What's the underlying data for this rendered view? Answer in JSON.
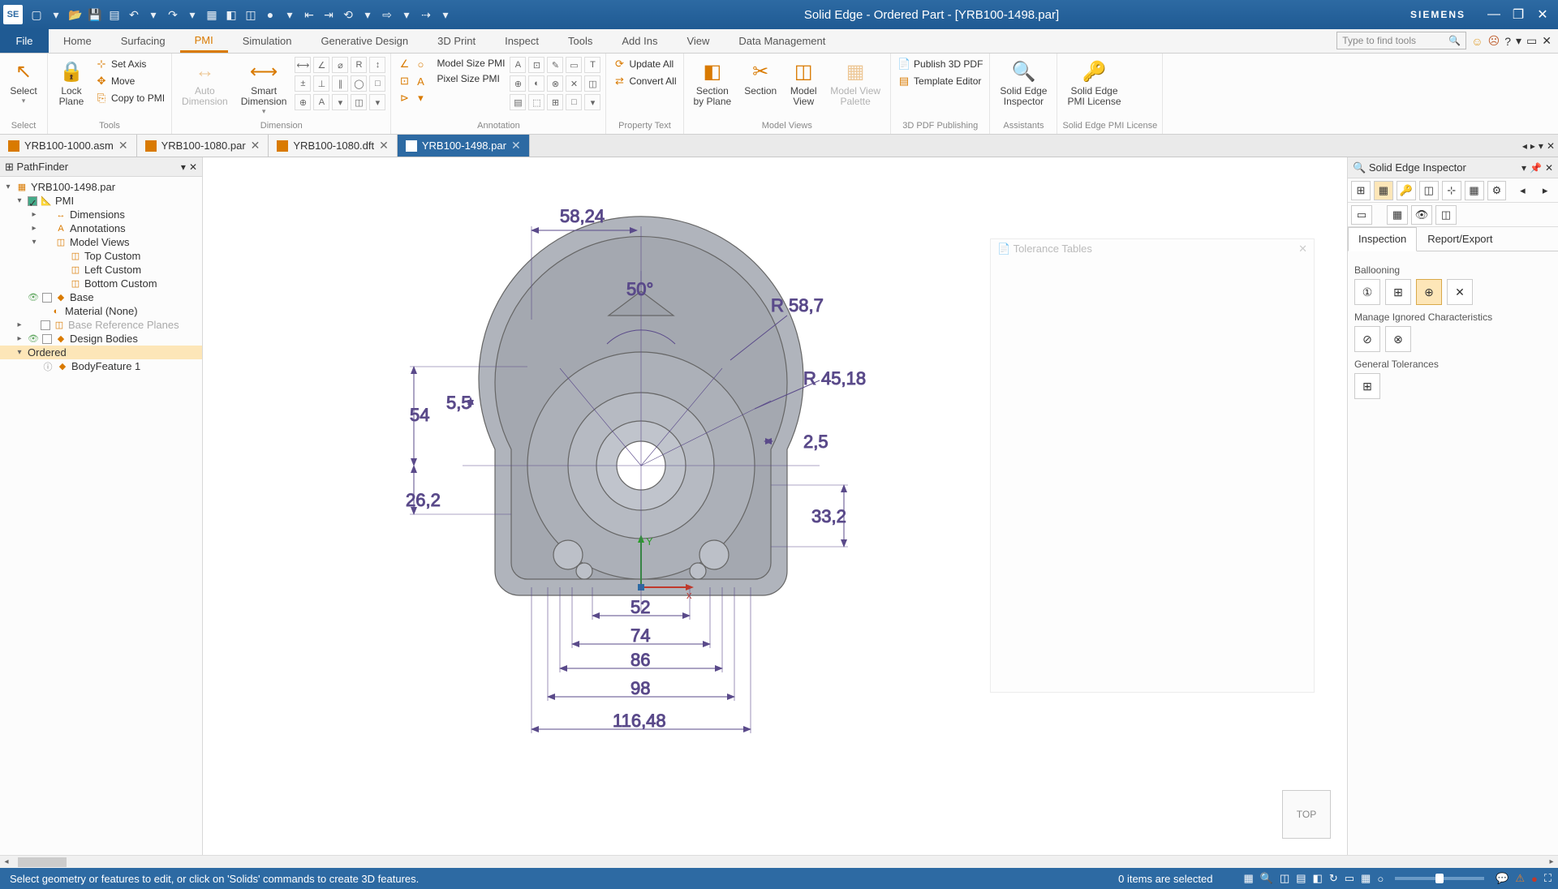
{
  "app": {
    "icon_text": "SE",
    "title": "Solid Edge - Ordered Part - [YRB100-1498.par]",
    "brand": "SIEMENS"
  },
  "qat_icons": [
    "file",
    "▾",
    "open",
    "save",
    "print",
    "⟲",
    "▾",
    "⟳",
    "▾",
    "grid",
    "cube",
    "ortho",
    "▦",
    "▾",
    "⇤",
    "⇥",
    "⇤",
    "▾",
    "⇥",
    "▾",
    "⇢",
    "▾"
  ],
  "menubar": {
    "file": "File",
    "tabs": [
      "Home",
      "Surfacing",
      "PMI",
      "Simulation",
      "Generative Design",
      "3D Print",
      "Inspect",
      "Tools",
      "Add Ins",
      "View",
      "Data Management"
    ],
    "active_index": 2,
    "find_placeholder": "Type to find tools",
    "help_icons": [
      "☺",
      "☹",
      "?",
      "▾",
      "□",
      "✕"
    ]
  },
  "ribbon": {
    "groups": {
      "select": {
        "big": "Select",
        "label": "Select"
      },
      "tools": {
        "big": {
          "label": "Lock\nPlane"
        },
        "items": [
          "Set Axis",
          "Move",
          "Copy to PMI"
        ],
        "label": "Tools"
      },
      "dimension": {
        "big1": {
          "label": "Auto\nDimension",
          "disabled": true
        },
        "big2": {
          "label": "Smart\nDimension"
        },
        "label": "Dimension"
      },
      "annotation": {
        "topitems": [
          "Model Size PMI",
          "Pixel Size PMI"
        ],
        "label": "Annotation"
      },
      "propertytext": {
        "items": [
          "Update All",
          "Convert All"
        ],
        "label": "Property Text"
      },
      "modelviews": {
        "big1": "Section\nby Plane",
        "big2": "Section",
        "big3": "Model\nView",
        "big4": "Model View\nPalette",
        "label": "Model Views"
      },
      "pdfpub": {
        "items": [
          "Publish 3D PDF",
          "Template Editor"
        ],
        "label": "3D PDF Publishing"
      },
      "assistants": {
        "big": "Solid Edge\nInspector",
        "label": "Assistants"
      },
      "license": {
        "big": "Solid Edge\nPMI License",
        "label": "Solid Edge PMI License"
      }
    }
  },
  "doctabs": [
    {
      "label": "YRB100-1000.asm",
      "active": false
    },
    {
      "label": "YRB100-1080.par",
      "active": false
    },
    {
      "label": "YRB100-1080.dft",
      "active": false
    },
    {
      "label": "YRB100-1498.par",
      "active": true
    }
  ],
  "pathfinder": {
    "title": "PathFinder",
    "tree": [
      {
        "lvl": 0,
        "tw": "▾",
        "label": "YRB100-1498.par",
        "ic": "▦"
      },
      {
        "lvl": 1,
        "tw": "▾",
        "label": "PMI",
        "ic": "📐",
        "chk": true
      },
      {
        "lvl": 2,
        "tw": "▸",
        "label": "Dimensions",
        "ic": "↔",
        "sub": true
      },
      {
        "lvl": 2,
        "tw": "▸",
        "label": "Annotations",
        "ic": "A",
        "sub": true
      },
      {
        "lvl": 2,
        "tw": "▾",
        "label": "Model Views",
        "ic": "◫",
        "sub": true
      },
      {
        "lvl": 3,
        "tw": "",
        "label": "Top Custom",
        "ic": "◫"
      },
      {
        "lvl": 3,
        "tw": "",
        "label": "Left Custom",
        "ic": "◫"
      },
      {
        "lvl": 3,
        "tw": "",
        "label": "Bottom Custom",
        "ic": "◫"
      },
      {
        "lvl": 1,
        "tw": "",
        "label": "Base",
        "ic": "◆",
        "chk": true,
        "vis": true
      },
      {
        "lvl": 1,
        "tw": "",
        "label": "Material (None)",
        "ic": "◐"
      },
      {
        "lvl": 1,
        "tw": "▸",
        "label": "Base Reference Planes",
        "ic": "◫",
        "grey": true,
        "chk": true
      },
      {
        "lvl": 1,
        "tw": "▸",
        "label": "Design Bodies",
        "ic": "◆",
        "chk": true,
        "vis": true
      },
      {
        "lvl": 1,
        "tw": "▾",
        "label": "Ordered",
        "sel": true
      },
      {
        "lvl": 2,
        "tw": "",
        "label": "BodyFeature 1",
        "ic": "◆",
        "info": true
      }
    ]
  },
  "dimensions": {
    "d1": "58,24",
    "d2": "50°",
    "d3": "R 58,7",
    "d4": "R 45,18",
    "d5": "5,5",
    "d6": "54",
    "d7": "26,2",
    "d8": "2,5",
    "d9": "33,2",
    "d10": "52",
    "d11": "74",
    "d12": "86",
    "d13": "98",
    "d14": "116,48"
  },
  "viewcube": {
    "label": "TOP",
    "axes": {
      "x": "x",
      "y": "Y"
    }
  },
  "tolerance_popup": {
    "title": "Tolerance Tables"
  },
  "inspector": {
    "title": "Solid Edge Inspector",
    "tabs": [
      "Inspection",
      "Report/Export"
    ],
    "active_tab": 0,
    "sections": {
      "ballooning": "Ballooning",
      "ignored": "Manage Ignored Characteristics",
      "tolerances": "General Tolerances"
    }
  },
  "statusbar": {
    "message": "Select geometry or features to edit, or click on 'Solids' commands to create 3D features.",
    "items_selected": "0 items are selected"
  }
}
